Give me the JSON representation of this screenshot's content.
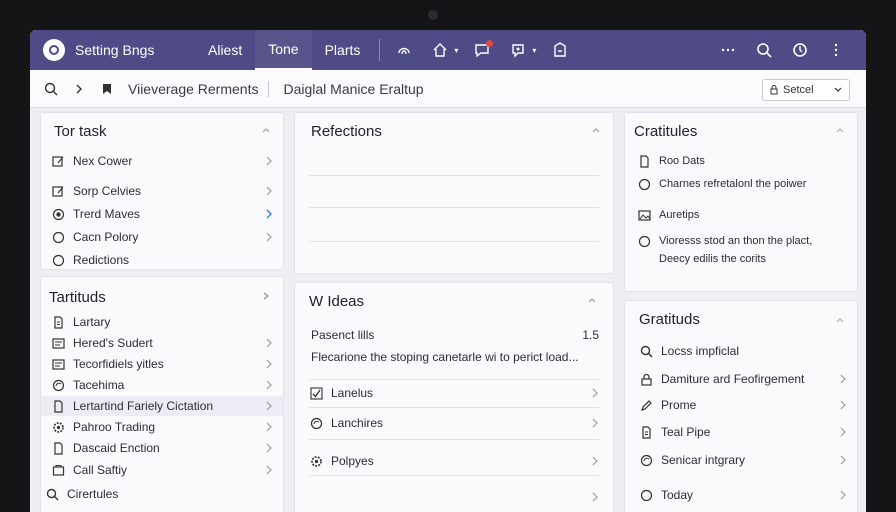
{
  "header": {
    "title": "Setting Bngs",
    "tabs": [
      {
        "label": "Aliest",
        "active": false
      },
      {
        "label": "Tone",
        "active": true
      },
      {
        "label": "Plarts",
        "active": false
      }
    ],
    "accent": "#4e4b86",
    "icons": [
      "fingerprint-icon",
      "home-icon",
      "chat-icon",
      "support-icon",
      "package-icon",
      "more-horizontal-icon",
      "search-icon",
      "timer-icon",
      "more-vertical-icon"
    ]
  },
  "subbar": {
    "crumb1": "Viieverage Rerments",
    "crumb2": "Daiglal Manice Eraltup",
    "select_value": "Setcel"
  },
  "panels": {
    "tortask": {
      "title": "Tor task",
      "items": [
        {
          "label": "Nex Cower",
          "icon": "edit-icon"
        },
        {
          "label": "Sorp Celvies",
          "icon": "edit-icon"
        },
        {
          "label": "Trerd Maves",
          "icon": "toggle-icon"
        },
        {
          "label": "Cacn Polory",
          "icon": "circle-icon"
        },
        {
          "label": "Redictions",
          "icon": "circle-icon"
        }
      ]
    },
    "tartituds": {
      "title": "Tartituds",
      "items": [
        {
          "label": "Lartary",
          "icon": "document-icon"
        },
        {
          "label": "Hered's Sudert",
          "icon": "document-icon"
        },
        {
          "label": "Tecorfidiels yitles",
          "icon": "document-icon"
        },
        {
          "label": "Tacehima",
          "icon": "refresh-icon"
        },
        {
          "label": "Lertartind Fariely Cictation",
          "icon": "document-icon"
        },
        {
          "label": "Pahroo Trading",
          "icon": "gear-icon"
        },
        {
          "label": "Dascaid Enction",
          "icon": "document-icon"
        },
        {
          "label": "Call Saftiy",
          "icon": "box-icon"
        },
        {
          "label": "Cirertules",
          "icon": "search-icon"
        }
      ]
    },
    "reflections": {
      "title": "Refections"
    },
    "ideas": {
      "title": "W Ideas",
      "note_label": "Pasenct lills",
      "note_value": "1.5",
      "note_text": "Flecarione the stoping canetarle wi to perict load...",
      "items": [
        {
          "label": "Lanelus",
          "icon": "check-icon"
        },
        {
          "label": "Lanchires",
          "icon": "refresh-icon"
        },
        {
          "label": "Polpyes",
          "icon": "gear-icon"
        }
      ]
    },
    "cratitules": {
      "title": "Cratitules",
      "items": [
        {
          "label": "Roo Dats",
          "icon": "document-icon"
        },
        {
          "label": "Charnes refretalonl the poiwer",
          "icon": "circle-icon"
        },
        {
          "label": "Auretips",
          "icon": "image-icon"
        },
        {
          "label": "Vioresss stod an thon the plact,",
          "icon": "circle-icon"
        },
        {
          "label": "Deecy edilis the corits",
          "icon": ""
        }
      ]
    },
    "gratituds": {
      "title": "Gratituds",
      "items": [
        {
          "label": "Locss impficlal",
          "icon": "search-icon"
        },
        {
          "label": "Damiture ard Feofirgement",
          "icon": "lock-icon"
        },
        {
          "label": "Prome",
          "icon": "edit-icon"
        },
        {
          "label": "Teal Pipe",
          "icon": "document-icon"
        },
        {
          "label": "Senicar intgrary",
          "icon": "refresh-icon"
        },
        {
          "label": "Today",
          "icon": "circle-icon"
        }
      ]
    }
  }
}
